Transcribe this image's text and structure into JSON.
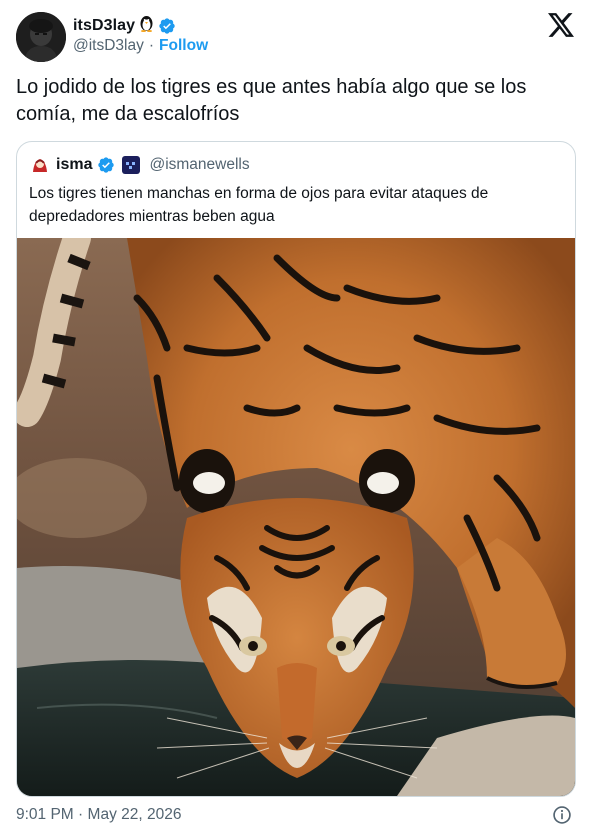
{
  "author": {
    "name": "itsD3lay",
    "handle": "@itsD3lay",
    "separator": "·",
    "follow_label": "Follow",
    "name_emoji": "penguin-icon",
    "verified_color": "#1d9bf0"
  },
  "platform_icon": "x-logo-icon",
  "tweet": {
    "text": "Lo jodido de los tigres es que antes había algo que se los comía, me da escalofríos"
  },
  "quoted": {
    "name": "isma",
    "handle": "@ismanewells",
    "text": "Los tigres tienen manchas en forma de ojos para evitar ataques de depredadores mientras beben agua",
    "image": "tiger-drinking-water-photo"
  },
  "footer": {
    "time": "9:01 PM",
    "separator": "·",
    "date": "May 22, 2026",
    "info_icon": "info-icon"
  },
  "colors": {
    "accent": "#1d9bf0",
    "secondary_text": "#536471",
    "border": "#cfd9de"
  }
}
